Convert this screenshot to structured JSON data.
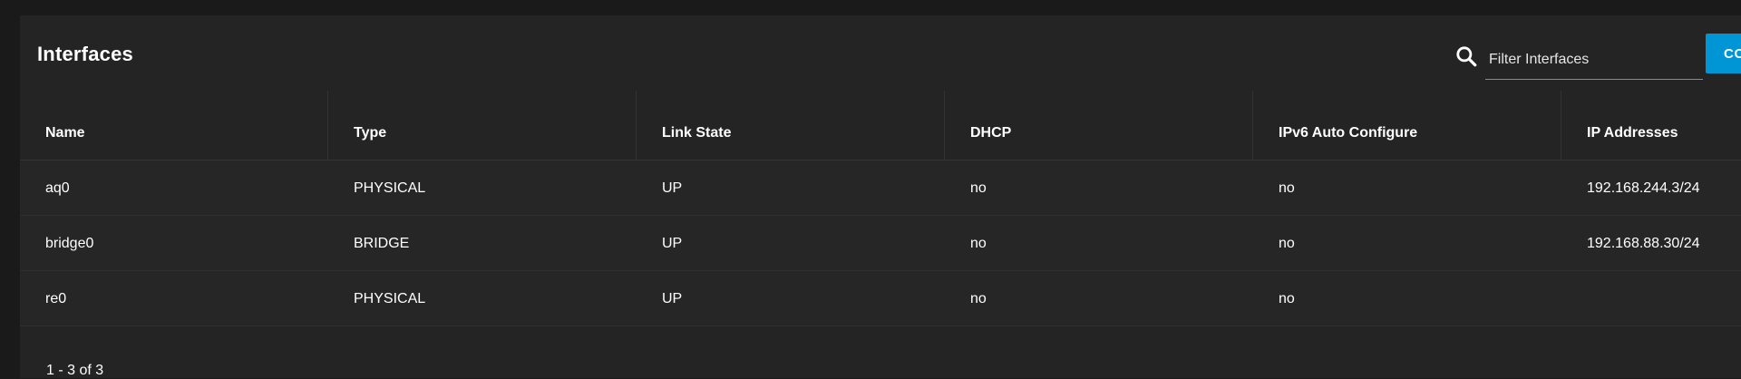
{
  "header": {
    "title": "Interfaces",
    "search_placeholder": "Filter Interfaces",
    "search_value": "",
    "action_label": "CO"
  },
  "table": {
    "columns": [
      "Name",
      "Type",
      "Link State",
      "DHCP",
      "IPv6 Auto Configure",
      "IP Addresses"
    ],
    "rows": [
      [
        "aq0",
        "PHYSICAL",
        "UP",
        "no",
        "no",
        "192.168.244.3/24"
      ],
      [
        "bridge0",
        "BRIDGE",
        "UP",
        "no",
        "no",
        "192.168.88.30/24"
      ],
      [
        "re0",
        "PHYSICAL",
        "UP",
        "no",
        "no",
        ""
      ]
    ]
  },
  "pagination": {
    "summary": "1 - 3 of 3"
  },
  "colors": {
    "accent": "#0095d5",
    "background": "#1a1a1a",
    "card": "#242424"
  }
}
